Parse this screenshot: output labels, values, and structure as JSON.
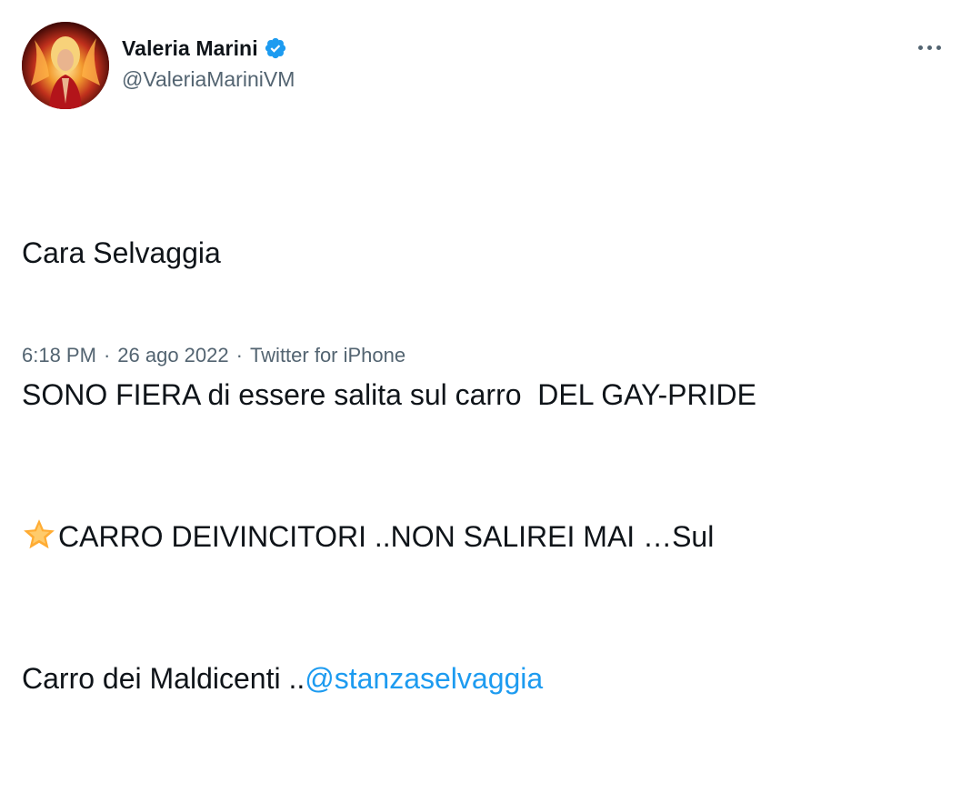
{
  "author": {
    "display_name": "Valeria Marini",
    "handle": "@ValeriaMariniVM",
    "verified_icon": "verified-badge-icon",
    "badge_color": "#1d9bf0"
  },
  "menu": {
    "icon": "more-options-icon"
  },
  "tweet": {
    "line1": "Cara Selvaggia",
    "line2": "SONO FIERA di essere salita sul carro  DEL GAY-PRIDE",
    "line3_emoji": "star-icon",
    "line3_text": "CARRO DEIVINCITORI ..NON SALIREI MAI …Sul",
    "line4_text": "Carro dei Maldicenti ..",
    "line4_mention": "@stanzaselvaggia",
    "link_color": "#1d9bf0"
  },
  "meta": {
    "time": "6:18 PM",
    "separator": "·",
    "date": "26 ago 2022",
    "source": "Twitter for iPhone"
  }
}
